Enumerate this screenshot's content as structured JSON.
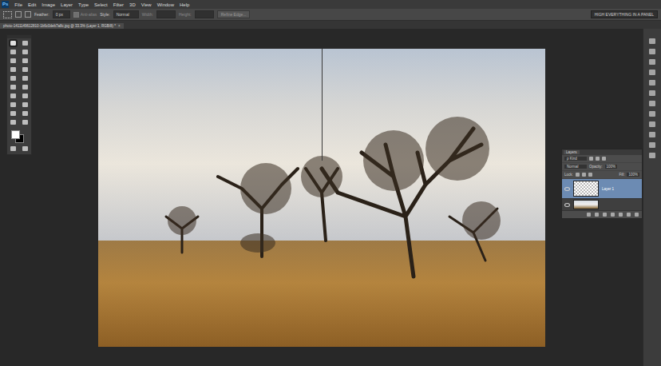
{
  "app_logo": "Ps",
  "menu": [
    "File",
    "Edit",
    "Image",
    "Layer",
    "Type",
    "Select",
    "Filter",
    "3D",
    "View",
    "Window",
    "Help"
  ],
  "options_bar": {
    "feather_label": "Feather:",
    "feather_value": "0 px",
    "anti_alias": {
      "label": "Anti-alias",
      "checked": true,
      "disabled": true
    },
    "style_label": "Style:",
    "style_value": "Normal",
    "width_label": "Width:",
    "height_label": "Height:",
    "refine_button": "Refine Edge...",
    "workspace_label": "HIGH EVERYTHING IN A PANEL"
  },
  "document_tab": {
    "title": "photo-1411149612810-1b6c0deb7a8c.jpg @ 33.3% (Layer 1, RGB/8) *",
    "close": "×"
  },
  "tools": [
    {
      "selected": true
    },
    {
      "selected": false
    },
    {
      "selected": false
    },
    {
      "selected": false
    },
    {
      "selected": false
    },
    {
      "selected": false
    },
    {
      "selected": false
    },
    {
      "selected": false
    },
    {
      "selected": false
    },
    {
      "selected": false
    },
    {
      "selected": false
    },
    {
      "selected": false
    },
    {
      "selected": false
    },
    {
      "selected": false
    },
    {
      "selected": false
    },
    {
      "selected": false
    },
    {
      "selected": false
    },
    {
      "selected": false
    },
    {
      "selected": false
    },
    {
      "selected": false
    }
  ],
  "swatches": {
    "foreground": "#ffffff",
    "background": "#000000"
  },
  "layers_panel": {
    "title": "Layers",
    "filter": "ρ Kind",
    "blend_mode": "Normal",
    "opacity_label": "Opacity:",
    "opacity_value": "100%",
    "lock_label": "Lock:",
    "fill_label": "Fill:",
    "fill_value": "100%",
    "layers": [
      {
        "name": "Layer 1",
        "selected": true,
        "visible": true,
        "kind": "transparent"
      },
      {
        "name": "",
        "selected": false,
        "visible": true,
        "kind": "image"
      }
    ]
  }
}
